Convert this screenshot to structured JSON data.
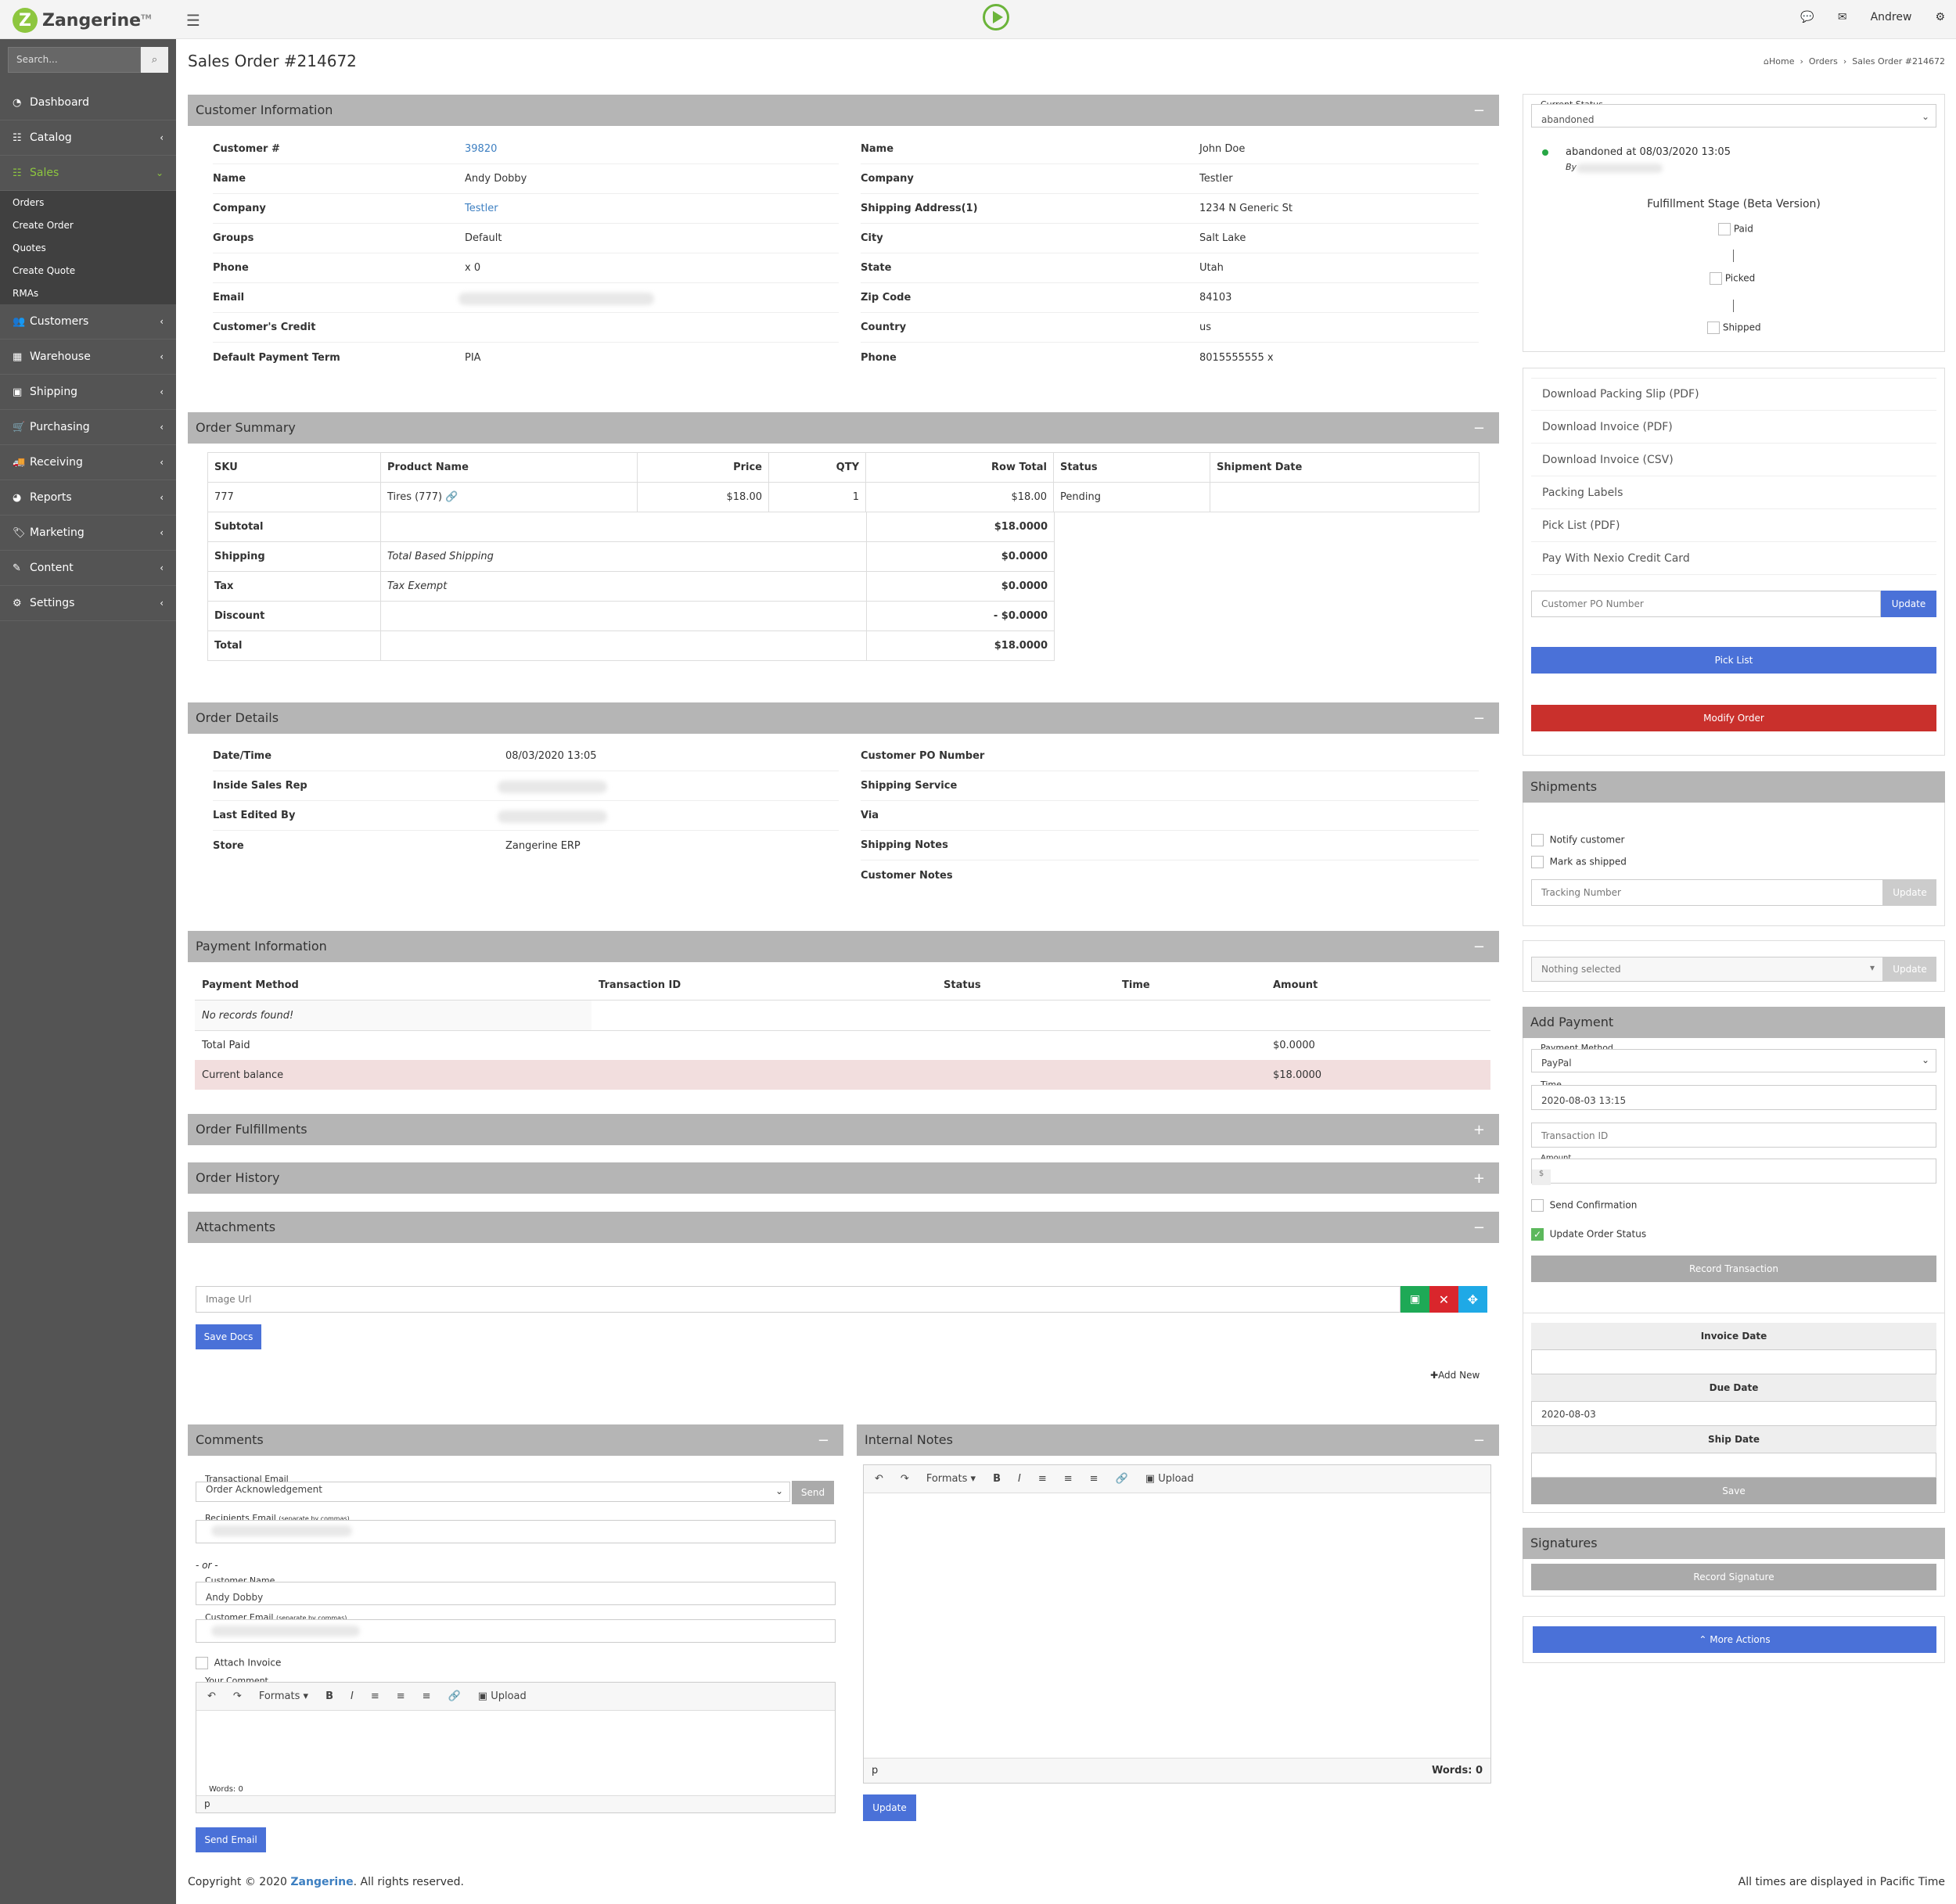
{
  "app": {
    "logo": "Zangerine",
    "tm": "TM",
    "user": "Andrew"
  },
  "sidebar": {
    "search_placeholder": "Search...",
    "items": [
      "Dashboard",
      "Catalog",
      "Sales",
      "Customers",
      "Warehouse",
      "Shipping",
      "Purchasing",
      "Receiving",
      "Reports",
      "Marketing",
      "Content",
      "Settings"
    ],
    "sales_sub": [
      "Orders",
      "Create Order",
      "Quotes",
      "Create Quote",
      "RMAs"
    ]
  },
  "page": {
    "title": "Sales Order #214672",
    "breadcrumb": [
      "Home",
      "Orders",
      "Sales Order #214672"
    ]
  },
  "customer_info": {
    "title": "Customer Information",
    "left": [
      {
        "k": "Customer #",
        "v": "39820"
      },
      {
        "k": "Name",
        "v": "Andy Dobby"
      },
      {
        "k": "Company",
        "v": "Testler"
      },
      {
        "k": "Groups",
        "v": "Default"
      },
      {
        "k": "Phone",
        "v": "x 0"
      },
      {
        "k": "Email",
        "v": ""
      },
      {
        "k": "Customer's Credit",
        "v": ""
      },
      {
        "k": "Default Payment Term",
        "v": "PIA"
      }
    ],
    "right": [
      {
        "k": "Name",
        "v": "John Doe"
      },
      {
        "k": "Company",
        "v": "Testler"
      },
      {
        "k": "Shipping Address(1)",
        "v": "1234 N Generic St"
      },
      {
        "k": "City",
        "v": "Salt Lake"
      },
      {
        "k": "State",
        "v": "Utah"
      },
      {
        "k": "Zip Code",
        "v": "84103"
      },
      {
        "k": "Country",
        "v": "us"
      },
      {
        "k": "Phone",
        "v": "8015555555 x"
      }
    ]
  },
  "order_summary": {
    "title": "Order Summary",
    "headers": [
      "SKU",
      "Product Name",
      "Price",
      "QTY",
      "Row Total",
      "Status",
      "Shipment Date"
    ],
    "row": [
      "777",
      "Tires (777)",
      "$18.00",
      "1",
      "$18.00",
      "Pending",
      ""
    ],
    "totals": [
      {
        "k": "Subtotal",
        "n": "",
        "v": "$18.0000"
      },
      {
        "k": "Shipping",
        "n": "Total Based Shipping",
        "v": "$0.0000"
      },
      {
        "k": "Tax",
        "n": "Tax Exempt",
        "v": "$0.0000"
      },
      {
        "k": "Discount",
        "n": "",
        "v": "- $0.0000"
      },
      {
        "k": "Total",
        "n": "",
        "v": "$18.0000"
      }
    ]
  },
  "order_details": {
    "title": "Order Details",
    "left": [
      {
        "k": "Date/Time",
        "v": "08/03/2020 13:05"
      },
      {
        "k": "Inside Sales Rep",
        "v": ""
      },
      {
        "k": "Last Edited By",
        "v": ""
      },
      {
        "k": "Store",
        "v": "Zangerine ERP"
      }
    ],
    "right": [
      "Customer PO Number",
      "Shipping Service",
      "Via",
      "Shipping Notes",
      "Customer Notes"
    ]
  },
  "payment": {
    "title": "Payment Information",
    "headers": [
      "Payment Method",
      "Transaction ID",
      "Status",
      "Time",
      "Amount"
    ],
    "empty": "No records found!",
    "total_paid_label": "Total Paid",
    "total_paid": "$0.0000",
    "balance_label": "Current balance",
    "balance": "$18.0000",
    "balance_color": "#f2dede"
  },
  "collapsed": [
    "Order Fulfillments",
    "Order History",
    "Attachments"
  ],
  "attachments": {
    "placeholder": "Image Url",
    "save": "Save Docs",
    "add_new": "Add New"
  },
  "comments": {
    "title": "Comments",
    "trans_label": "Transactional Email",
    "trans_value": "Order Acknowledgement",
    "send": "Send",
    "recip_label": "Recipients Email",
    "sep_note": "(separate by commas)",
    "or": "- or -",
    "cname_label": "Customer Name",
    "cname_value": "Andy Dobby",
    "cemail_label": "Customer Email",
    "attach": "Attach Invoice",
    "your_comment": "Your Comment",
    "formats": "Formats",
    "upload": "Upload",
    "words": "Words: 0",
    "p": "p",
    "send_email": "Send Email"
  },
  "internal": {
    "title": "Internal Notes",
    "formats": "Formats",
    "upload": "Upload",
    "p": "p",
    "words": "Words: 0",
    "update": "Update"
  },
  "status": {
    "label": "Current Status",
    "value": "abandoned",
    "history": "abandoned at 08/03/2020 13:05",
    "by": "By",
    "stage_title": "Fulfillment Stage (Beta Version)",
    "stages": [
      "Paid",
      "Picked",
      "Shipped"
    ]
  },
  "actions": {
    "links": [
      "Download Packing Slip (PDF)",
      "Download Invoice (PDF)",
      "Download Invoice (CSV)",
      "Packing Labels",
      "Pick List (PDF)",
      "Pay With Nexio Credit Card"
    ],
    "po_placeholder": "Customer PO Number",
    "update": "Update",
    "pick_list": "Pick List",
    "modify": "Modify Order"
  },
  "shipments": {
    "title": "Shipments",
    "notify": "Notify customer",
    "mark": "Mark as shipped",
    "tracking": "Tracking Number",
    "update": "Update",
    "nothing": "Nothing selected",
    "update2": "Update"
  },
  "add_payment": {
    "title": "Add Payment",
    "method_label": "Payment Method",
    "method_value": "PayPal",
    "time_label": "Time",
    "time_value": "2020-08-03 13:15",
    "txn_placeholder": "Transaction ID",
    "amount_label": "Amount",
    "currency": "$",
    "send_conf": "Send Confirmation",
    "update_status": "Update Order Status",
    "record": "Record Transaction"
  },
  "dates": {
    "invoice": "Invoice Date",
    "due": "Due Date",
    "due_value": "2020-08-03",
    "ship": "Ship Date",
    "save": "Save"
  },
  "signatures": {
    "title": "Signatures",
    "record": "Record Signature"
  },
  "more": "More Actions",
  "footer": {
    "copy": "Copyright © 2020",
    "brand": "Zangerine",
    "rest": ". All rights reserved.",
    "tz": "All times are displayed in Pacific Time"
  }
}
